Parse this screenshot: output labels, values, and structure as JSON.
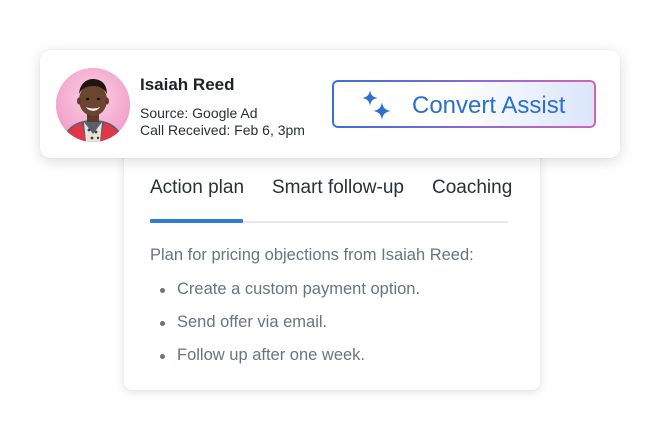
{
  "contact": {
    "name": "Isaiah Reed",
    "source": "Source: Google Ad",
    "call_received": "Call Received: Feb 6, 3pm"
  },
  "assist_button": {
    "label": "Convert Assist",
    "icon": "sparkle-icon"
  },
  "tabs": [
    {
      "label": "Action plan",
      "active": true
    },
    {
      "label": "Smart follow-up",
      "active": false
    },
    {
      "label": "Coaching",
      "active": false
    }
  ],
  "plan": {
    "heading": "Plan for pricing objections from Isaiah Reed:",
    "items": [
      "Create a custom payment option.",
      "Send offer via email.",
      "Follow up after one week."
    ]
  },
  "colors": {
    "accent": "#2f7cd8",
    "assist_text": "#2b6fcf",
    "assist_gradient_start": "#3b6fd1",
    "assist_gradient_end": "#d763b4",
    "muted_text": "#6b7280"
  }
}
